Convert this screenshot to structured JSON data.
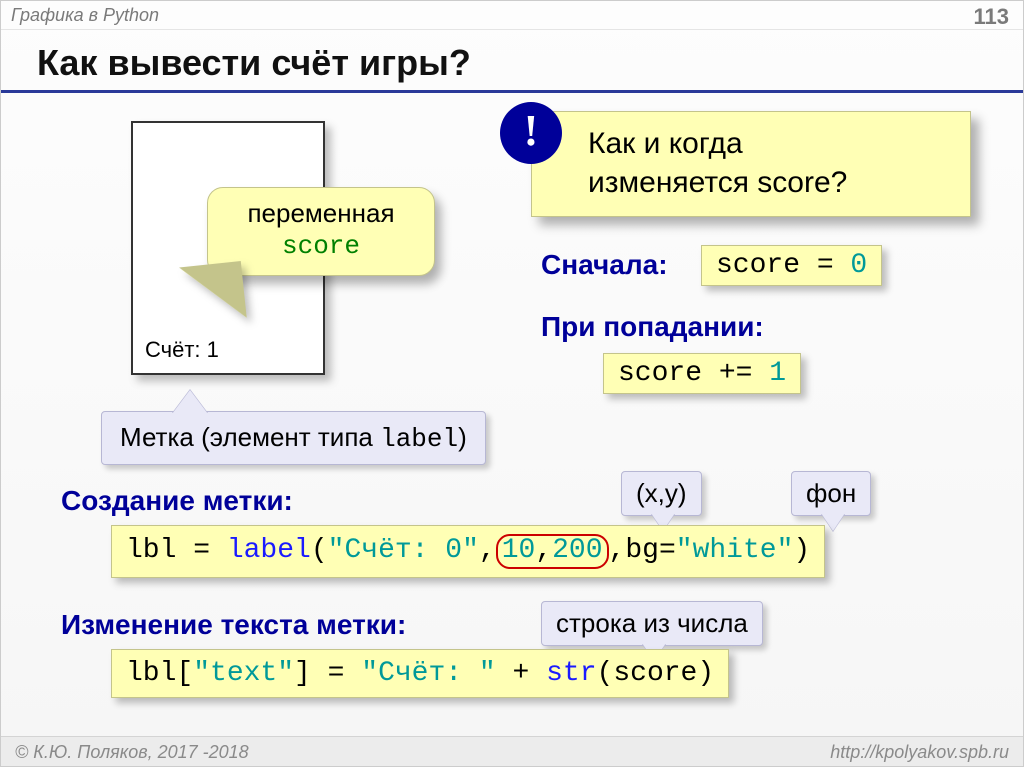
{
  "topbar": "Графика в Python",
  "page": "113",
  "title": "Как вывести счёт игры?",
  "canvas": {
    "score_label": "Счёт: 1"
  },
  "bubble_var": {
    "line1": "переменная",
    "line2_code": "score"
  },
  "label_caption": {
    "text": "Метка (элемент типа ",
    "code": "label",
    "tail": ")"
  },
  "callout": {
    "line1": "Как и когда",
    "line2": "изменяется score?"
  },
  "start_label": "Сначала:",
  "hit_label": "При попадании:",
  "code_start": {
    "lhs": "score = ",
    "val": "0"
  },
  "code_hit": {
    "lhs": "score += ",
    "val": "1"
  },
  "section_create": "Создание метки:",
  "section_change": "Изменение текста метки:",
  "code_create": {
    "p1": "lbl = ",
    "fn": "label",
    "p2": "(",
    "str": "\"Счёт: 0\"",
    "p3": ",",
    "x": "10",
    "c1": ",",
    "y": "200",
    "p4": ",bg=",
    "bg": "\"white\"",
    "p5": ")"
  },
  "code_change": {
    "p1": "lbl[",
    "key": "\"text\"",
    "p2": "] = ",
    "lit": "\"Счёт: \"",
    "p3": " + ",
    "fn": "str",
    "p4": "(score)"
  },
  "mini_xy": "(x,y)",
  "mini_bg": "фон",
  "mini_str": "строка из числа",
  "footer_left": "© К.Ю. Поляков, 2017 -2018",
  "footer_right": "http://kpolyakov.spb.ru"
}
